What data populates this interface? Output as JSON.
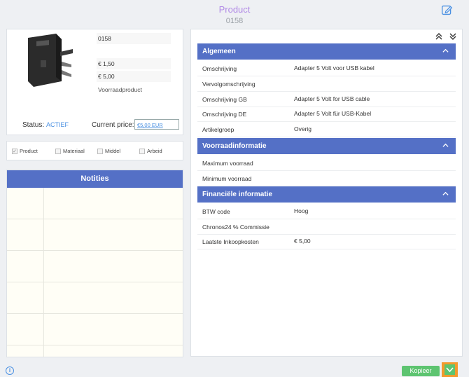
{
  "header": {
    "title": "Product",
    "code": "0158"
  },
  "product": {
    "code": "0158",
    "price1": "€ 1,50",
    "price2": "€ 5,00",
    "type": "Voorraadproduct",
    "status_label": "Status:",
    "status_value": "ACTIEF",
    "current_price_label": "Current price:",
    "current_price_value": "€5,00 EUR"
  },
  "checkboxes": [
    {
      "label": "Product",
      "checked": true
    },
    {
      "label": "Materiaal",
      "checked": false
    },
    {
      "label": "Middel",
      "checked": false
    },
    {
      "label": "Arbeid",
      "checked": false
    }
  ],
  "notes": {
    "title": "Notities"
  },
  "sections": {
    "general": {
      "title": "Algemeen",
      "rows": [
        {
          "label": "Omschrijving",
          "value": "Adapter 5 Volt voor USB kabel"
        },
        {
          "label": "Vervolgomschrijving",
          "value": ""
        },
        {
          "label": "Omschrijving GB",
          "value": "Adapter 5 Volt for USB cable"
        },
        {
          "label": "Omschrijving DE",
          "value": "Adapter 5 Volt für USB-Kabel"
        },
        {
          "label": "Artikelgroep",
          "value": "Overig"
        }
      ]
    },
    "stock": {
      "title": "Voorraadinformatie",
      "rows": [
        {
          "label": "Maximum voorraad",
          "value": ""
        },
        {
          "label": "Minimum voorraad",
          "value": ""
        }
      ]
    },
    "finance": {
      "title": "Financiële informatie",
      "rows": [
        {
          "label": "BTW code",
          "value": "Hoog"
        },
        {
          "label": "Chronos24 % Commissie",
          "value": ""
        },
        {
          "label": "Laatste Inkoopkosten",
          "value": "€ 5,00"
        }
      ]
    }
  },
  "footer": {
    "copy_label": "Kopieer",
    "info_glyph": "i"
  },
  "colors": {
    "accent": "#5470c6",
    "title": "#b18ae6",
    "link": "#4a90e2",
    "green": "#5dc470",
    "orange": "#f39a2c"
  }
}
